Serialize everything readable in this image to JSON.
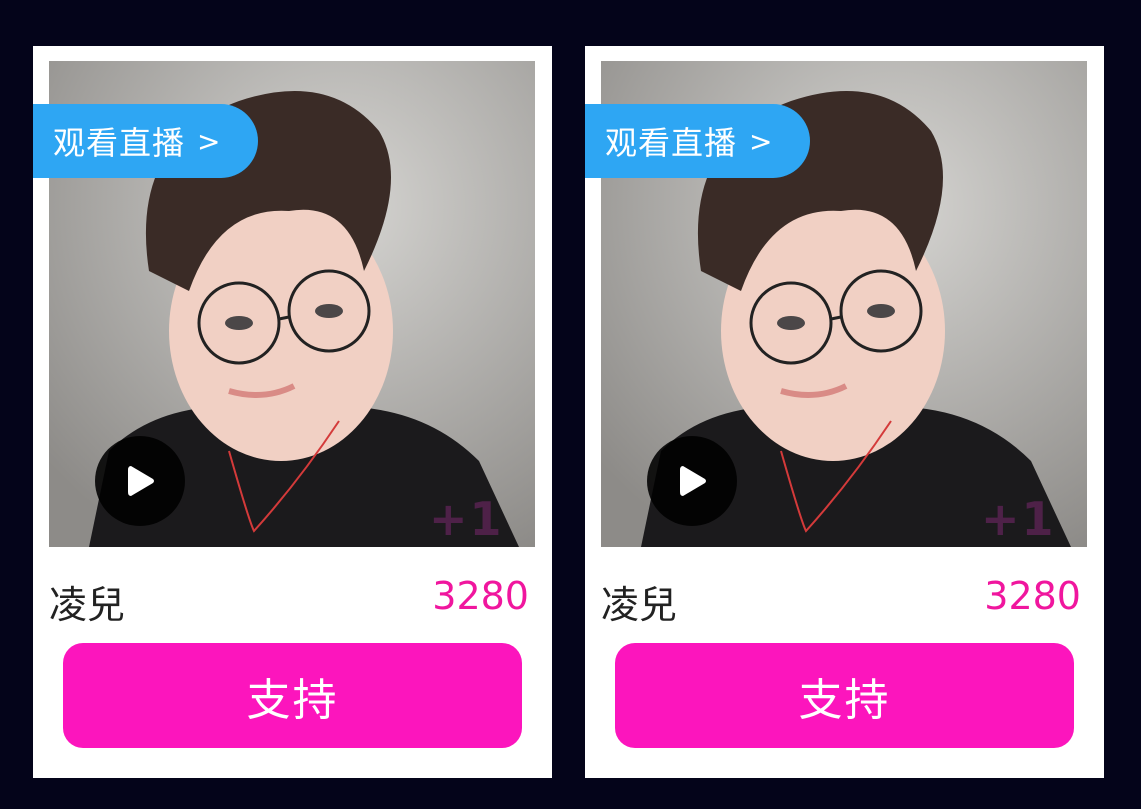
{
  "cards": [
    {
      "watch_label": "观看直播",
      "watch_chevron": ">",
      "name": "凌兒",
      "count": "3280",
      "support_label": "支持",
      "badge": "+1"
    },
    {
      "watch_label": "观看直播",
      "watch_chevron": ">",
      "name": "凌兒",
      "count": "3280",
      "support_label": "支持",
      "badge": "+1"
    }
  ],
  "colors": {
    "background": "#04041a",
    "watch_button": "#2ea6f3",
    "support_button": "#fc15bd",
    "count_text": "#f0169e"
  },
  "icons": {
    "play": "play-icon",
    "chevron": "chevron-right"
  }
}
